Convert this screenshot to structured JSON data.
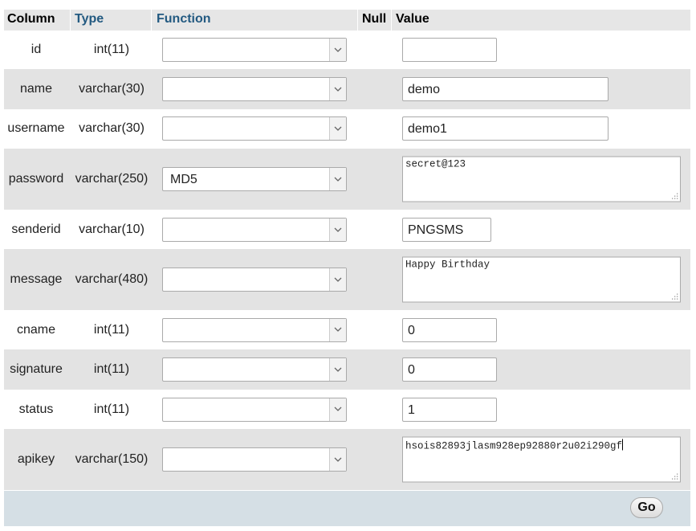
{
  "headers": {
    "column": "Column",
    "type": "Type",
    "function": "Function",
    "null": "Null",
    "value": "Value"
  },
  "rows": [
    {
      "column": "id",
      "type": "int(11)",
      "function": "",
      "value": ""
    },
    {
      "column": "name",
      "type": "varchar(30)",
      "function": "",
      "value": "demo"
    },
    {
      "column": "username",
      "type": "varchar(30)",
      "function": "",
      "value": "demo1"
    },
    {
      "column": "password",
      "type": "varchar(250)",
      "function": "MD5",
      "value": "secret@123"
    },
    {
      "column": "senderid",
      "type": "varchar(10)",
      "function": "",
      "value": "PNGSMS"
    },
    {
      "column": "message",
      "type": "varchar(480)",
      "function": "",
      "value": "Happy Birthday"
    },
    {
      "column": "cname",
      "type": "int(11)",
      "function": "",
      "value": "0"
    },
    {
      "column": "signature",
      "type": "int(11)",
      "function": "",
      "value": "0"
    },
    {
      "column": "status",
      "type": "int(11)",
      "function": "",
      "value": "1"
    },
    {
      "column": "apikey",
      "type": "varchar(150)",
      "function": "",
      "value": "hsois82893jlasm928ep92880r2u02i290gf"
    }
  ],
  "footer": {
    "go_label": "Go"
  },
  "icons": {
    "dropdown_arrow": "chevron-down-icon",
    "resize_grip": "resize-grip-icon"
  }
}
